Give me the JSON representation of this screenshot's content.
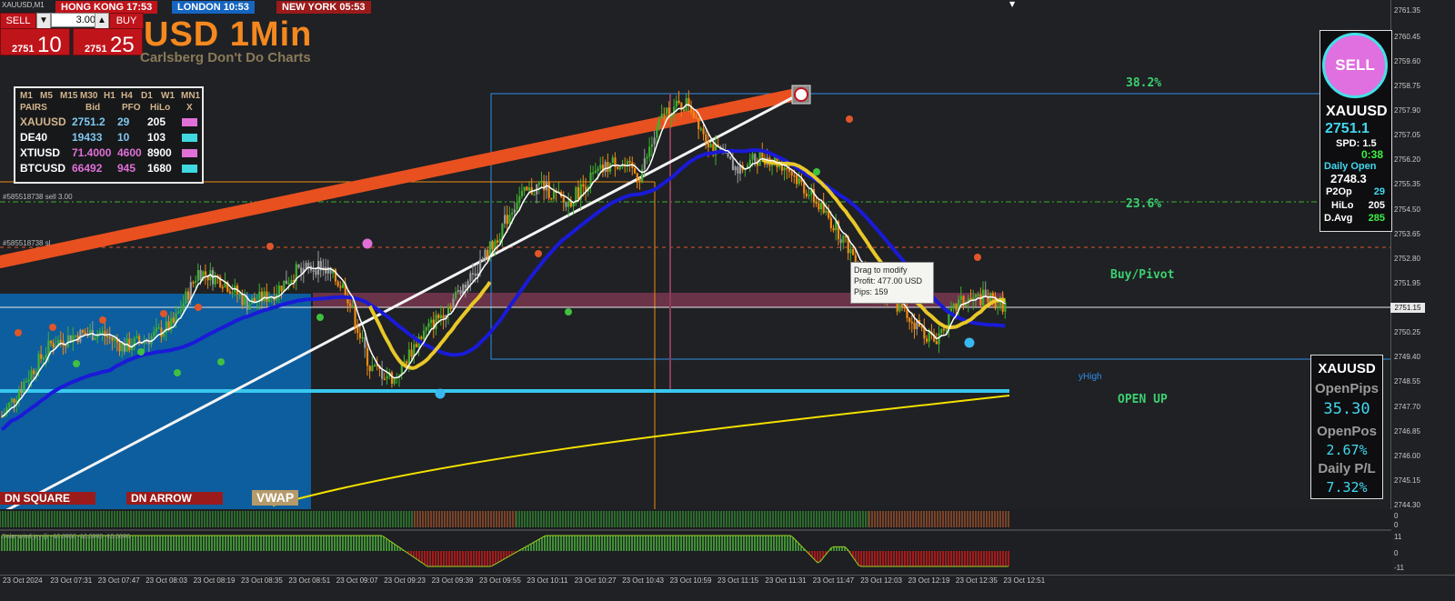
{
  "window": {
    "symbol_title": "XAUUSD,M1"
  },
  "clocks": [
    {
      "label": "HONG KONG 17:53"
    },
    {
      "label": "LONDON 10:53"
    },
    {
      "label": "NEW YORK 05:53"
    }
  ],
  "colors": {
    "clock_hk": "#c0141b",
    "clock_ldn": "#1565c0",
    "clock_ny": "#9b1a1a",
    "bull": "#40b030",
    "bear": "#f08a12",
    "neutral": "#9a9a9a",
    "ma_blue": "#1a1ad8",
    "ma_yellow": "#e8c828",
    "vwap": "#f4e000",
    "trend_red": "#e85020",
    "box_blue": "#0d5e9e",
    "fib": "#2f8fe8"
  },
  "trade_panel": {
    "sell_label": "SELL",
    "buy_label": "BUY",
    "lot_value": "3.00",
    "sell_price_small": "2751",
    "sell_price_big": "10",
    "buy_price_small": "2751",
    "buy_price_big": "25"
  },
  "chart_heading": {
    "title": "USD 1Min",
    "subtitle": "Carlsberg Don't Do Charts"
  },
  "mtf_panel": {
    "timeframes": [
      "M1",
      "M5",
      "M15",
      "M30",
      "H1",
      "H4",
      "D1",
      "W1",
      "MN1"
    ],
    "headers": [
      "PAIRS",
      "Bid",
      "PFO",
      "HiLo",
      "X"
    ],
    "rows": [
      {
        "pair": "XAUUSD",
        "bid": "2751.2",
        "pfo": "29",
        "hilo": "205",
        "color": "#d2b48c",
        "bidcolor": "#7ec8f0",
        "swatch": "#e070d8"
      },
      {
        "pair": "DE40",
        "bid": "19433",
        "pfo": "10",
        "hilo": "103",
        "color": "#ffffff",
        "bidcolor": "#7ec8f0",
        "swatch": "#40d8e0"
      },
      {
        "pair": "XTIUSD",
        "bid": "71.4000",
        "pfo": "4600",
        "hilo": "8900",
        "color": "#ffffff",
        "bidcolor": "#e070d8",
        "swatch": "#e070d8"
      },
      {
        "pair": "BTCUSD",
        "bid": "66492",
        "pfo": "945",
        "hilo": "1680",
        "color": "#ffffff",
        "bidcolor": "#e070d8",
        "swatch": "#40d8e0"
      }
    ]
  },
  "right_panel": {
    "signal": "SELL",
    "symbol": "XAUUSD",
    "price": "2751.1",
    "spread_label": "SPD: 1.5",
    "timer": "0:38",
    "daily_open_label": "Daily Open",
    "daily_open": "2748.3",
    "p2op_label": "P2Op",
    "p2op": "29",
    "hilo_label": "HiLo",
    "hilo": "205",
    "davg_label": "D.Avg",
    "davg": "285"
  },
  "positions_panel": {
    "symbol": "XAUUSD",
    "open_pips_label": "OpenPips",
    "open_pips": "35.30",
    "open_pos_label": "OpenPos",
    "open_pos": "2.67%",
    "daily_pl_label": "Daily P/L",
    "daily_pl": "7.32%"
  },
  "levels": {
    "fib_382": "38.2%",
    "fib_236": "23.6%",
    "buy_pivot": "Buy/Pivot",
    "open_up": "OPEN UP",
    "yhigh": "yHigh",
    "order_sell": "#585518738 sell 3.00",
    "order_sl": "#585518738 sl"
  },
  "tooltip": {
    "line1": "Drag to modify",
    "line2": "Profit: 477.00 USD",
    "line3": "Pips: 159"
  },
  "bottom_labels": {
    "dn_square": "DN SQUARE",
    "dn_arrow": "DN ARROW",
    "vwap": "VWAP"
  },
  "indicator": {
    "label": "Solar wind joy (): -10.0000 -10.0000 -10.0000",
    "ticks": [
      "11",
      "0",
      "-11"
    ],
    "strip_ticks": [
      "0",
      "0"
    ]
  },
  "price_axis": {
    "ticks": [
      "2761.35",
      "2760.45",
      "2759.60",
      "2758.75",
      "2757.90",
      "2757.05",
      "2756.20",
      "2755.35",
      "2754.50",
      "2753.65",
      "2752.80",
      "2751.95",
      "2750.25",
      "2749.40",
      "2748.55",
      "2747.70",
      "2746.85",
      "2746.00",
      "2745.15",
      "2744.30"
    ],
    "current": "2751.15"
  },
  "time_axis": {
    "ticks": [
      "23 Oct 2024",
      "23 Oct 07:31",
      "23 Oct 07:47",
      "23 Oct 08:03",
      "23 Oct 08:19",
      "23 Oct 08:35",
      "23 Oct 08:51",
      "23 Oct 09:07",
      "23 Oct 09:23",
      "23 Oct 09:39",
      "23 Oct 09:55",
      "23 Oct 10:11",
      "23 Oct 10:27",
      "23 Oct 10:43",
      "23 Oct 10:59",
      "23 Oct 11:15",
      "23 Oct 11:31",
      "23 Oct 11:47",
      "23 Oct 12:03",
      "23 Oct 12:19",
      "23 Oct 12:35",
      "23 Oct 12:51"
    ]
  },
  "chart_data": {
    "type": "candlestick",
    "timeframe": "M1",
    "ylim": [
      2744.3,
      2761.35
    ],
    "current_price": 2751.15,
    "fib_levels": {
      "38.2%": 2758.6,
      "23.6%": 2754.9
    },
    "close_path": [
      [
        0,
        2747.4
      ],
      [
        10,
        2748.7
      ],
      [
        20,
        2749.9
      ],
      [
        30,
        2750.2
      ],
      [
        40,
        2750.3
      ],
      [
        50,
        2749.8
      ],
      [
        60,
        2750.1
      ],
      [
        70,
        2750.6
      ],
      [
        80,
        2752.4
      ],
      [
        90,
        2752.1
      ],
      [
        100,
        2751.3
      ],
      [
        110,
        2751.6
      ],
      [
        120,
        2752.4
      ],
      [
        130,
        2752.6
      ],
      [
        140,
        2751.8
      ],
      [
        150,
        2749.1
      ],
      [
        160,
        2748.7
      ],
      [
        170,
        2750.1
      ],
      [
        180,
        2751.0
      ],
      [
        190,
        2752.1
      ],
      [
        200,
        2753.3
      ],
      [
        210,
        2754.9
      ],
      [
        220,
        2755.4
      ],
      [
        230,
        2754.7
      ],
      [
        240,
        2755.6
      ],
      [
        250,
        2756.2
      ],
      [
        260,
        2755.7
      ],
      [
        270,
        2757.9
      ],
      [
        280,
        2758.2
      ],
      [
        290,
        2756.6
      ],
      [
        300,
        2755.9
      ],
      [
        310,
        2756.4
      ],
      [
        320,
        2756.0
      ],
      [
        330,
        2755.0
      ],
      [
        340,
        2753.9
      ],
      [
        350,
        2752.6
      ],
      [
        360,
        2751.6
      ],
      [
        370,
        2750.8
      ],
      [
        380,
        2750.0
      ],
      [
        390,
        2751.3
      ],
      [
        400,
        2751.5
      ],
      [
        410,
        2751.2
      ]
    ]
  }
}
